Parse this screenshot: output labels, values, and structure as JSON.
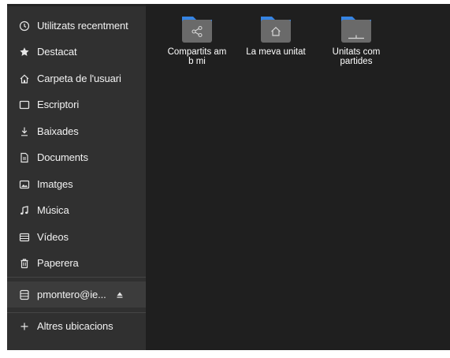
{
  "sidebar": {
    "items": [
      {
        "label": "Utilitzats recentment",
        "icon": "clock-icon"
      },
      {
        "label": "Destacat",
        "icon": "star-icon"
      },
      {
        "label": "Carpeta de l'usuari",
        "icon": "home-icon"
      },
      {
        "label": "Escriptori",
        "icon": "desktop-icon"
      },
      {
        "label": "Baixades",
        "icon": "download-icon"
      },
      {
        "label": "Documents",
        "icon": "document-icon"
      },
      {
        "label": "Imatges",
        "icon": "image-icon"
      },
      {
        "label": "Música",
        "icon": "music-icon"
      },
      {
        "label": "Vídeos",
        "icon": "video-icon"
      },
      {
        "label": "Paperera",
        "icon": "trash-icon"
      }
    ],
    "mount": {
      "label": "pmontero@ie...",
      "icon": "drive-icon",
      "action_icon": "eject-icon"
    },
    "other": {
      "label": "Altres ubicacions",
      "icon": "plus-icon"
    }
  },
  "files": [
    {
      "label": "Compartits amb mi",
      "icon": "share-icon"
    },
    {
      "label": "La meva unitat",
      "icon": "home-icon"
    },
    {
      "label": "Unitats compartides",
      "icon": "drive-icon"
    }
  ],
  "colors": {
    "sidebar_bg": "#303030",
    "main_bg": "#1f1f1f",
    "folder_blue": "#3584e4",
    "folder_gray": "#6a6a6a"
  }
}
